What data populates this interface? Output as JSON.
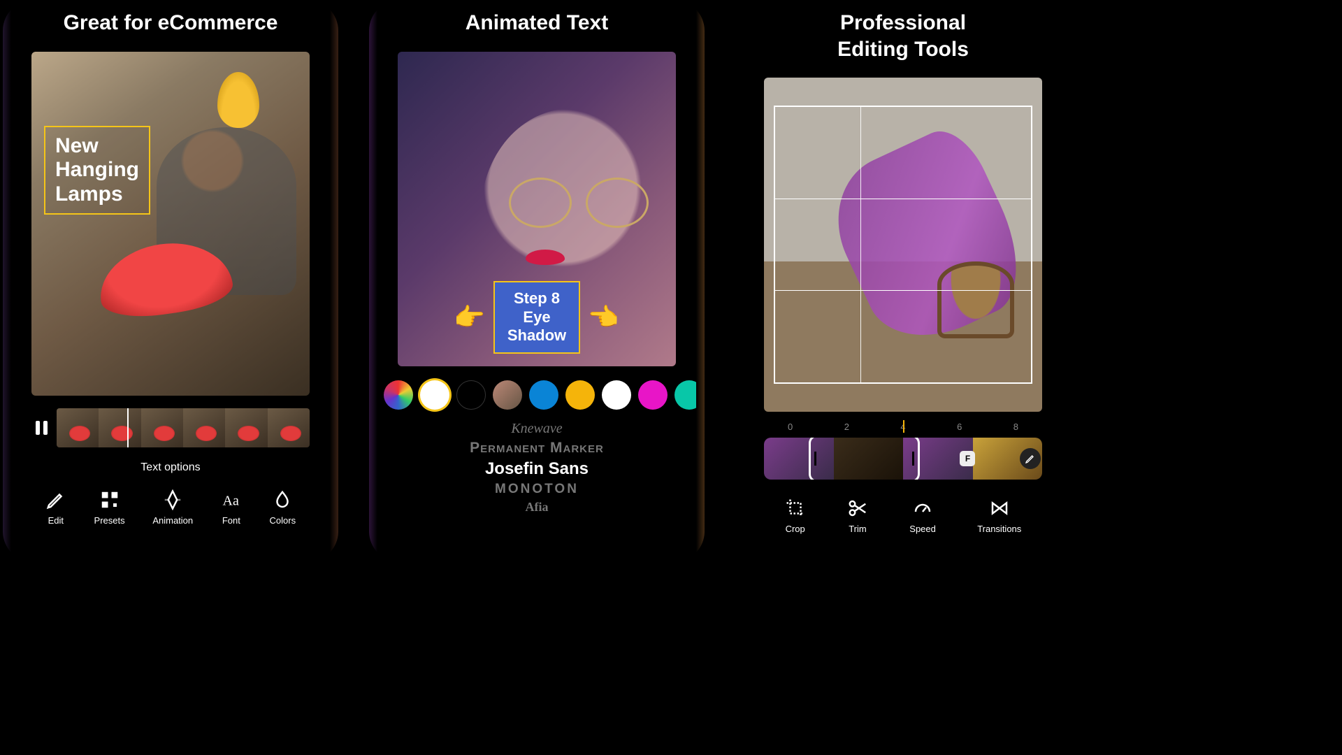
{
  "panel1": {
    "title": "Great for eCommerce",
    "overlay_text": "New\nHanging\nLamps",
    "section_label": "Text options",
    "tools": [
      {
        "id": "edit",
        "label": "Edit"
      },
      {
        "id": "presets",
        "label": "Presets"
      },
      {
        "id": "animation",
        "label": "Animation"
      },
      {
        "id": "font",
        "label": "Font"
      },
      {
        "id": "colors",
        "label": "Colors"
      }
    ]
  },
  "panel2": {
    "title": "Animated Text",
    "overlay_line1": "Step 8",
    "overlay_line2": "Eye Shadow",
    "colors": [
      {
        "id": "multi",
        "name": "multicolor"
      },
      {
        "id": "white",
        "name": "white",
        "selected": true
      },
      {
        "id": "black",
        "name": "black"
      },
      {
        "id": "grad",
        "name": "gradient"
      },
      {
        "id": "blue",
        "name": "blue"
      },
      {
        "id": "yellow",
        "name": "yellow"
      },
      {
        "id": "white2",
        "name": "white"
      },
      {
        "id": "magenta",
        "name": "magenta"
      },
      {
        "id": "teal",
        "name": "teal"
      }
    ],
    "fonts": [
      {
        "name": "Knewave",
        "cls": "fi-knewave"
      },
      {
        "name": "Permanent Marker",
        "cls": "fi-perm"
      },
      {
        "name": "Josefin Sans",
        "cls": "sel"
      },
      {
        "name": "MONOTON",
        "cls": "fi-monoton"
      },
      {
        "name": "Afia",
        "cls": "fi-afia"
      }
    ]
  },
  "panel3": {
    "title": "Professional\nEditing Tools",
    "ruler": [
      "0",
      "2",
      "4",
      "6",
      "8"
    ],
    "badge": "F",
    "tools": [
      {
        "id": "crop",
        "label": "Crop"
      },
      {
        "id": "trim",
        "label": "Trim"
      },
      {
        "id": "speed",
        "label": "Speed"
      },
      {
        "id": "transitions",
        "label": "Transitions"
      }
    ]
  }
}
